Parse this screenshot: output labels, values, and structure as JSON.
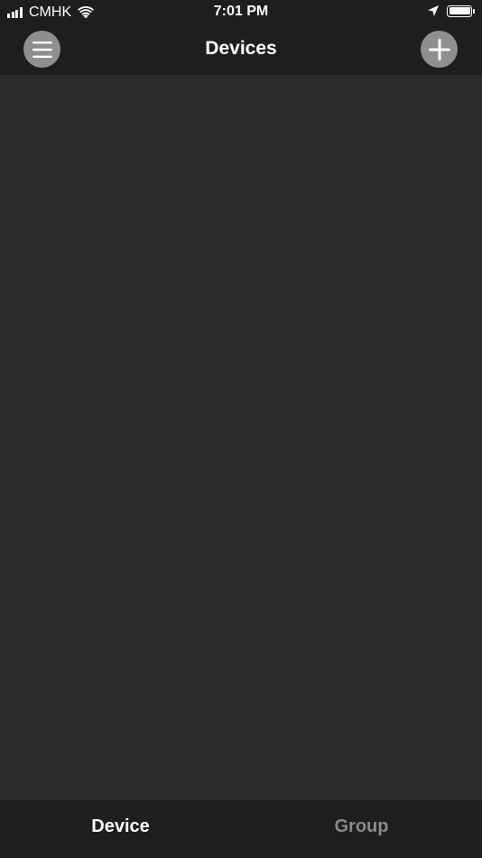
{
  "status_bar": {
    "carrier": "CMHK",
    "time": "7:01 PM",
    "icons": [
      "signal-icon",
      "wifi-icon",
      "location-icon",
      "battery-icon"
    ]
  },
  "nav_bar": {
    "title": "Devices",
    "left_button_icon": "menu-icon",
    "right_button_icon": "plus-icon"
  },
  "tabs": [
    {
      "label": "Device",
      "active": true
    },
    {
      "label": "Group",
      "active": false
    }
  ],
  "colors": {
    "background": "#2b2b2b",
    "bar_background": "#1e1e1e",
    "button_gray": "#8f8f8f",
    "active_tab": "#ffffff",
    "inactive_tab": "#8a8a8a"
  }
}
